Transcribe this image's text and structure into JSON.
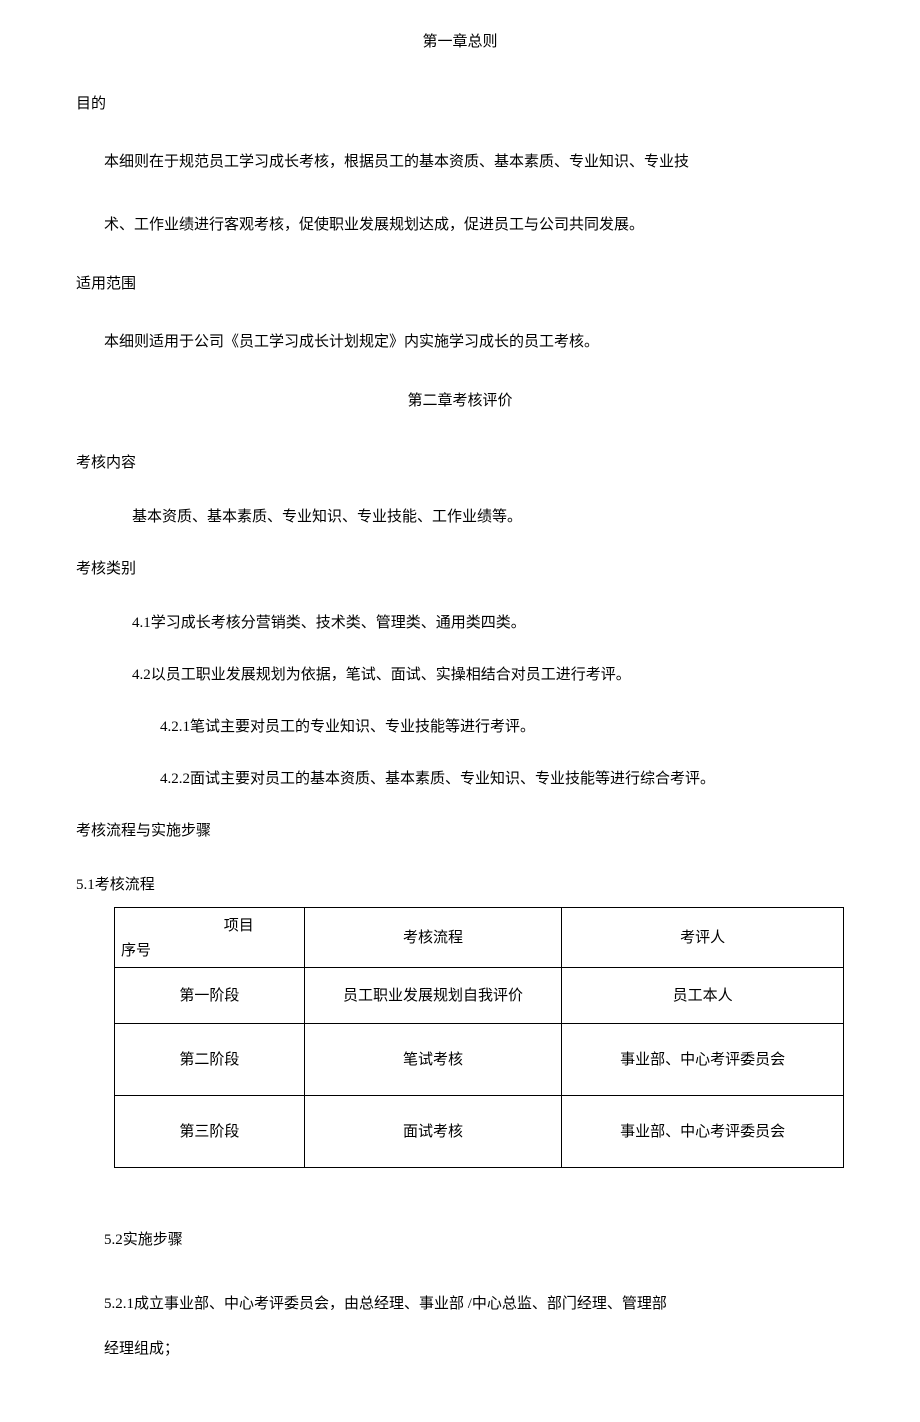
{
  "chapter1_title": "第一章总则",
  "s1_label": "目的",
  "s1_p1": "本细则在于规范员工学习成长考核，根据员工的基本资质、基本素质、专业知识、专业技",
  "s1_p2": "术、工作业绩进行客观考核，促使职业发展规划达成，促进员工与公司共同发展。",
  "s2_label": "适用范围",
  "s2_p1": "本细则适用于公司《员工学习成长计划规定》内实施学习成长的员工考核。",
  "chapter2_title": "第二章考核评价",
  "s3_label": "考核内容",
  "s3_p1": "基本资质、基本素质、专业知识、专业技能、工作业绩等。",
  "s4_label": "考核类别",
  "s4_1": "4.1学习成长考核分营销类、技术类、管理类、通用类四类。",
  "s4_2": "4.2以员工职业发展规划为依据，笔试、面试、实操相结合对员工进行考评。",
  "s4_2_1": "4.2.1笔试主要对员工的专业知识、专业技能等进行考评。",
  "s4_2_2": "4.2.2面试主要对员工的基本资质、基本素质、专业知识、专业技能等进行综合考评。",
  "s5_label": "考核流程与实施步骤",
  "s5_1_label": "5.1考核流程",
  "table": {
    "head_diag_top": "项目",
    "head_diag_bot": "序号",
    "head_c2": "考核流程",
    "head_c3": "考评人",
    "rows": [
      {
        "c1": "第一阶段",
        "c2": "员工职业发展规划自我评价",
        "c3": "员工本人"
      },
      {
        "c1": "第二阶段",
        "c2": "笔试考核",
        "c3": "事业部、中心考评委员会"
      },
      {
        "c1": "第三阶段",
        "c2": "面试考核",
        "c3": "事业部、中心考评委员会"
      }
    ]
  },
  "s5_2_label": "5.2实施步骤",
  "s5_2_1a": "5.2.1成立事业部、中心考评委员会，由总经理、事业部 /中心总监、部门经理、管理部",
  "s5_2_1b": "经理组成；"
}
